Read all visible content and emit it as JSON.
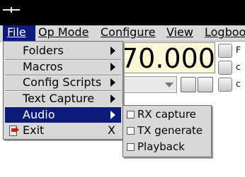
{
  "menubar": {
    "items": [
      {
        "label": "File"
      },
      {
        "label": "Op Mode"
      },
      {
        "label": "Configure"
      },
      {
        "label": "View"
      },
      {
        "label": "Logbook"
      }
    ]
  },
  "main": {
    "frequency": "70.000",
    "side_labels": [
      "F",
      "c",
      "c"
    ]
  },
  "file_menu": {
    "items": [
      {
        "label": "Folders",
        "has_submenu": true
      },
      {
        "label": "Macros",
        "has_submenu": true
      },
      {
        "label": "Config Scripts",
        "has_submenu": true
      },
      {
        "label": "Text Capture",
        "has_submenu": true
      },
      {
        "label": "Audio",
        "has_submenu": true,
        "selected": true
      },
      {
        "label": "Exit",
        "shortcut": "X",
        "icon": "exit-icon"
      }
    ]
  },
  "audio_menu": {
    "items": [
      {
        "label": "RX capture",
        "checked": false
      },
      {
        "label": "TX generate",
        "checked": false
      },
      {
        "label": "Playback",
        "checked": false
      }
    ]
  },
  "colors": {
    "menu_bg": "#d8d8d8",
    "selection": "#0c1a7a",
    "frequency_bg": "#fdf8d8"
  }
}
